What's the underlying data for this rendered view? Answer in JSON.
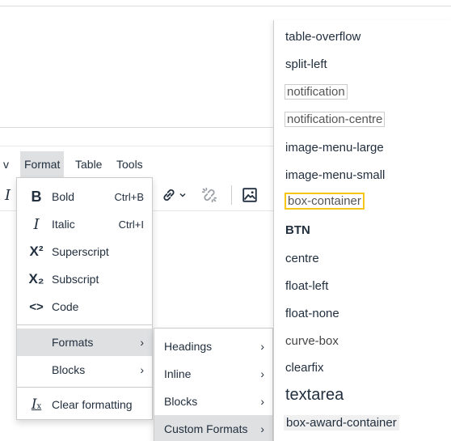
{
  "menubar": {
    "cut_item": "v",
    "items": [
      {
        "label": "Format",
        "active": true
      },
      {
        "label": "Table",
        "active": false
      },
      {
        "label": "Tools",
        "active": false
      }
    ]
  },
  "toolbar": {
    "cut_icon": "I",
    "link_icon": "link-icon",
    "unlink_icon": "unlink-icon",
    "image_icon": "image-icon"
  },
  "format_menu": {
    "items": [
      {
        "icon": "B",
        "label": "Bold",
        "shortcut": "Ctrl+B"
      },
      {
        "icon": "I",
        "label": "Italic",
        "shortcut": "Ctrl+I"
      },
      {
        "icon": "X²",
        "label": "Superscript"
      },
      {
        "icon": "X₂",
        "label": "Subscript"
      },
      {
        "icon": "<>",
        "label": "Code"
      },
      {
        "label": "Formats",
        "arrow": "›",
        "active": true
      },
      {
        "label": "Blocks",
        "arrow": "›"
      },
      {
        "icon": "Ix",
        "label": "Clear formatting"
      }
    ]
  },
  "formats_menu": {
    "items": [
      {
        "label": "Headings",
        "arrow": "›"
      },
      {
        "label": "Inline",
        "arrow": "›"
      },
      {
        "label": "Blocks",
        "arrow": "›"
      },
      {
        "label": "Custom Formats",
        "arrow": "›",
        "active": true
      }
    ]
  },
  "custom_formats": {
    "items": [
      "table-overflow",
      "split-left",
      "notification",
      "notification-centre",
      "image-menu-large",
      "image-menu-small",
      "box-container",
      "BTN",
      "centre",
      "float-left",
      "float-none",
      "curve-box",
      "clearfix",
      "textarea",
      "box-award-container"
    ]
  },
  "colors": {
    "active_bg": "#dee0e2",
    "highlight_border": "#f5c518",
    "text": "#222f3e"
  }
}
